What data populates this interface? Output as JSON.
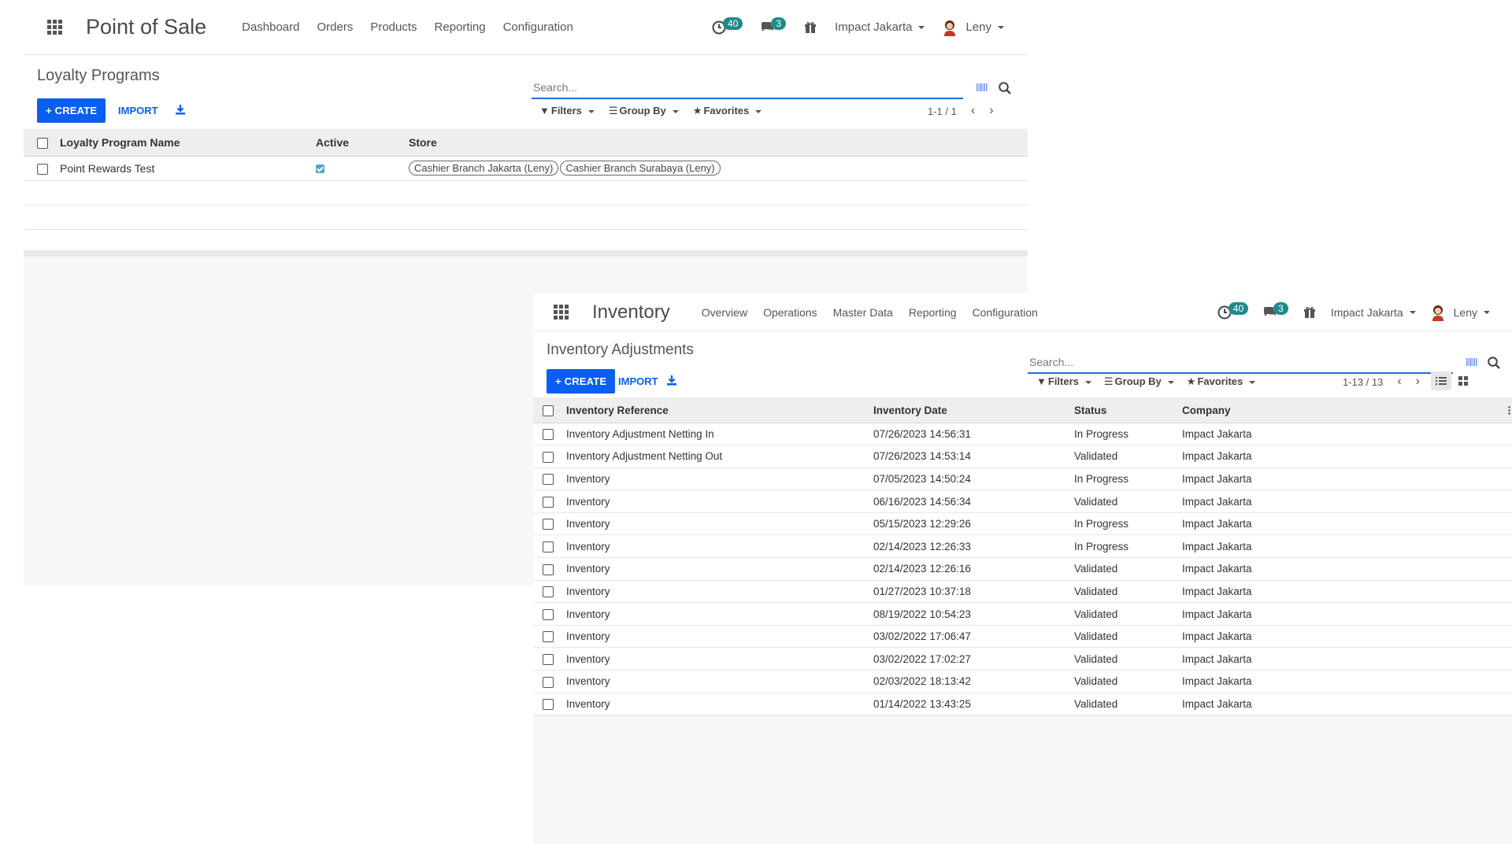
{
  "pos": {
    "app_title": "Point of Sale",
    "menu": [
      "Dashboard",
      "Orders",
      "Products",
      "Reporting",
      "Configuration"
    ],
    "systray": {
      "activity_count": "40",
      "messages_count": "3",
      "company": "Impact Jakarta",
      "user": "Leny"
    },
    "breadcrumb": "Loyalty Programs",
    "create_label": "CREATE",
    "import_label": "IMPORT",
    "search_placeholder": "Search...",
    "filters_label": "Filters",
    "groupby_label": "Group By",
    "favorites_label": "Favorites",
    "pager": "1-1 / 1",
    "columns": [
      "Loyalty Program Name",
      "Active",
      "Store"
    ],
    "rows": [
      {
        "name": "Point Rewards Test",
        "active": true,
        "stores": [
          "Cashier Branch Jakarta (Leny)",
          "Cashier Branch Surabaya (Leny)"
        ]
      }
    ]
  },
  "inv": {
    "app_title": "Inventory",
    "menu": [
      "Overview",
      "Operations",
      "Master Data",
      "Reporting",
      "Configuration"
    ],
    "systray": {
      "activity_count": "40",
      "messages_count": "3",
      "company": "Impact Jakarta",
      "user": "Leny"
    },
    "breadcrumb": "Inventory Adjustments",
    "create_label": "CREATE",
    "import_label": "IMPORT",
    "search_placeholder": "Search...",
    "filters_label": "Filters",
    "groupby_label": "Group By",
    "favorites_label": "Favorites",
    "pager": "1-13 / 13",
    "columns": [
      "Inventory Reference",
      "Inventory Date",
      "Status",
      "Company"
    ],
    "rows": [
      {
        "ref": "Inventory Adjustment Netting In",
        "date": "07/26/2023 14:56:31",
        "status": "In Progress",
        "company": "Impact Jakarta"
      },
      {
        "ref": "Inventory Adjustment Netting Out",
        "date": "07/26/2023 14:53:14",
        "status": "Validated",
        "company": "Impact Jakarta"
      },
      {
        "ref": "Inventory",
        "date": "07/05/2023 14:50:24",
        "status": "In Progress",
        "company": "Impact Jakarta"
      },
      {
        "ref": "Inventory",
        "date": "06/16/2023 14:56:34",
        "status": "Validated",
        "company": "Impact Jakarta"
      },
      {
        "ref": "Inventory",
        "date": "05/15/2023 12:29:26",
        "status": "In Progress",
        "company": "Impact Jakarta"
      },
      {
        "ref": "Inventory",
        "date": "02/14/2023 12:26:33",
        "status": "In Progress",
        "company": "Impact Jakarta"
      },
      {
        "ref": "Inventory",
        "date": "02/14/2023 12:26:16",
        "status": "Validated",
        "company": "Impact Jakarta"
      },
      {
        "ref": "Inventory",
        "date": "01/27/2023 10:37:18",
        "status": "Validated",
        "company": "Impact Jakarta"
      },
      {
        "ref": "Inventory",
        "date": "08/19/2022 10:54:23",
        "status": "Validated",
        "company": "Impact Jakarta"
      },
      {
        "ref": "Inventory",
        "date": "03/02/2022 17:06:47",
        "status": "Validated",
        "company": "Impact Jakarta"
      },
      {
        "ref": "Inventory",
        "date": "03/02/2022 17:02:27",
        "status": "Validated",
        "company": "Impact Jakarta"
      },
      {
        "ref": "Inventory",
        "date": "02/03/2022 18:13:42",
        "status": "Validated",
        "company": "Impact Jakarta"
      },
      {
        "ref": "Inventory",
        "date": "01/14/2022 13:43:25",
        "status": "Validated",
        "company": "Impact Jakarta"
      }
    ]
  },
  "icons": {
    "apps": "apps-grid-icon",
    "activity": "clock-icon",
    "messages": "chat-icon",
    "gift": "gift-icon",
    "download": "download-icon",
    "barcode": "barcode-icon",
    "search": "search-icon",
    "list_view": "list-view-icon",
    "kanban_view": "kanban-view-icon"
  },
  "colors": {
    "primary": "#0a5ef0",
    "badge": "#1f8b8b",
    "search_underline": "#1f6fd9"
  }
}
